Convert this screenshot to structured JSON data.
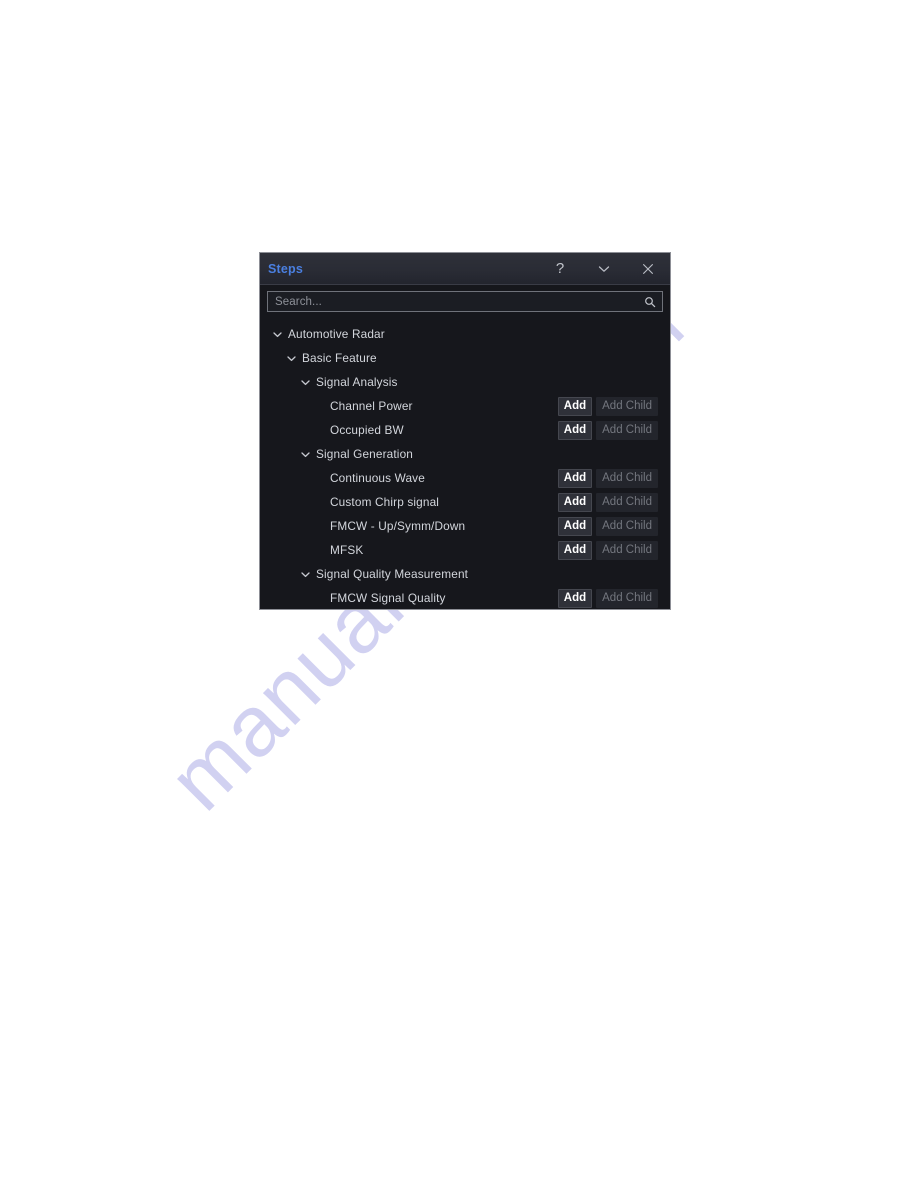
{
  "watermark": {
    "text": "manualshive.com"
  },
  "panel": {
    "title": "Steps",
    "header_buttons": [
      {
        "name": "help-icon",
        "label": "?"
      },
      {
        "name": "chevron-down-icon",
        "label": ""
      },
      {
        "name": "close-icon",
        "label": ""
      }
    ],
    "search": {
      "placeholder": "Search...",
      "value": "",
      "icon": "search-icon"
    },
    "tree": {
      "add_label": "Add",
      "add_child_label": "Add Child",
      "rows": [
        {
          "label": "Automotive Radar",
          "depth": 0,
          "expandable": true,
          "expanded": true,
          "has_actions": false
        },
        {
          "label": "Basic Feature",
          "depth": 1,
          "expandable": true,
          "expanded": true,
          "has_actions": false
        },
        {
          "label": "Signal Analysis",
          "depth": 2,
          "expandable": true,
          "expanded": true,
          "has_actions": false
        },
        {
          "label": "Channel Power",
          "depth": 3,
          "expandable": false,
          "expanded": false,
          "has_actions": true
        },
        {
          "label": "Occupied BW",
          "depth": 3,
          "expandable": false,
          "expanded": false,
          "has_actions": true
        },
        {
          "label": "Signal Generation",
          "depth": 2,
          "expandable": true,
          "expanded": true,
          "has_actions": false
        },
        {
          "label": "Continuous Wave",
          "depth": 3,
          "expandable": false,
          "expanded": false,
          "has_actions": true
        },
        {
          "label": "Custom Chirp signal",
          "depth": 3,
          "expandable": false,
          "expanded": false,
          "has_actions": true
        },
        {
          "label": "FMCW - Up/Symm/Down",
          "depth": 3,
          "expandable": false,
          "expanded": false,
          "has_actions": true
        },
        {
          "label": "MFSK",
          "depth": 3,
          "expandable": false,
          "expanded": false,
          "has_actions": true
        },
        {
          "label": "Signal Quality Measurement",
          "depth": 2,
          "expandable": true,
          "expanded": true,
          "has_actions": false
        },
        {
          "label": "FMCW Signal Quality",
          "depth": 3,
          "expandable": false,
          "expanded": false,
          "has_actions": true
        }
      ]
    }
  },
  "colors": {
    "page_background": "#ffffff",
    "panel_background": "#16171c",
    "panel_border": "#8d8f96",
    "header_background": "#2b2d36",
    "title_accent": "#4a7fe0",
    "row_text": "#d3d6dc",
    "add_button_text": "#ffffff",
    "add_child_text": "#73767e",
    "watermark": "#c9c9ef"
  }
}
